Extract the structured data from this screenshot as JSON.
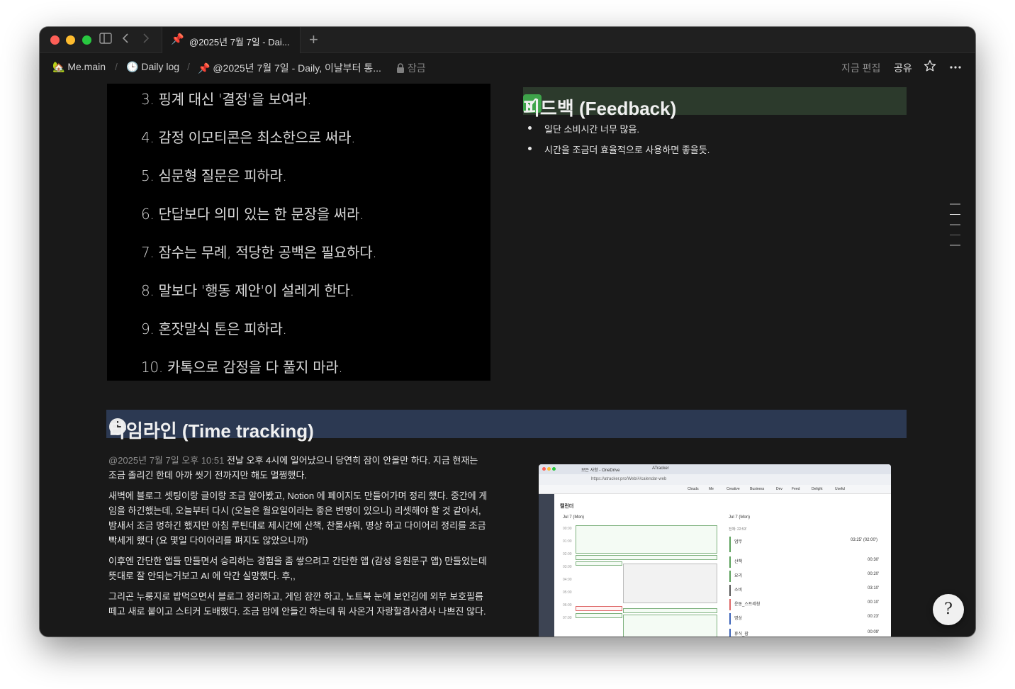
{
  "window": {
    "tab_title": "@2025년 7월 7일 - Dai...",
    "new_tab_symbol": "+"
  },
  "breadcrumb": {
    "items": [
      {
        "icon": "house-plant-emoji",
        "label": "Me.main"
      },
      {
        "icon": "clock-emoji",
        "label": "Daily log"
      },
      {
        "icon": "pushpin-emoji",
        "label": "@2025년 7월 7일 - Daily, 이날부터 통..."
      }
    ],
    "lock_label": "잠금"
  },
  "topbar": {
    "edit_label": "지금 편집",
    "share_label": "공유"
  },
  "rules_image": {
    "lines": [
      "3. 핑계 대신 '결정'을 보여라.",
      "4. 감정 이모티콘은 최소한으로 써라.",
      "5. 심문형 질문은 피하라.",
      "6. 단답보다 의미 있는 한 문장을 써라.",
      "7. 잠수는 무례, 적당한 공백은 필요하다.",
      "8. 말보다 '행동 제안'이 설레게 한다.",
      "9. 혼잣말식 톤은 피하라.",
      "10. 카톡으로 감정을 다 풀지 마라."
    ]
  },
  "feedback": {
    "heading": "피드백 (Feedback)",
    "heading_color": "#2c3a2c",
    "items": [
      "일단 소비시간 너무 많음.",
      "시간을 조금더 효율적으로 사용하면 좋을듯."
    ]
  },
  "timeline": {
    "heading": "타임라인 (Time tracking)",
    "heading_color": "#2c3952",
    "mention": "@2025년 7월 7일 오후 10:51",
    "p1_rest": " 전날 오후 4시에 일어났으니 당연히 잠이 안올만 하다. 지금 현재는 조금 졸리긴 한데 아까 씻기 전까지만 해도 멀쩡했다.",
    "p2": "새벽에 블로그 셋팅이랑 글이랑 조금 알아봤고, Notion 에 페이지도 만들어가며 정리 했다. 중간에 게임을 하긴했는데, 오늘부터 다시 (오늘은 월요일이라는 좋은 변명이 있으니) 리셋해야 할 것 같아서, 밤새서 조금 멍하긴 했지만 아침 루틴대로 제시간에 산책, 찬물샤워, 명상 하고 다이어리 정리를 조금 빡세게 했다 (요 몇일 다이어리를 펴지도 않았으니까)",
    "p3": "이후엔 간단한 앱들 만들면서 승리하는 경험을 좀 쌓으려고 간단한 앱 (감성 응원문구 앱) 만들었는데 뜻대로 잘 안되는거보고 AI 에 약간 실망했다. 후,,",
    "p4": "그리곤 누룽지로 밥먹으면서 블로그 정리하고, 게임 잠깐 하고, 노트북 눈에 보인김에 외부 보호필름 떼고 새로 붙이고 스티커 도배했다. 조금 맘에 안들긴 하는데 뭐 사온거 자랑할겸사겸사 나쁘진 않다."
  },
  "embedded_screenshot": {
    "tab1": "모든 사항 - OneDrive",
    "tab2": "ATracker",
    "url": "https://atracker.pro/Web/#/calendar-web",
    "bookmarks": [
      "Clouds",
      "Me",
      "Creative",
      "Business",
      "Dev",
      "Feed",
      "Delight",
      "Useful"
    ],
    "calendar_title": "캘린더",
    "date_left": "Jul 7 (Mon)",
    "date_right": "Jul 7 (Mon)",
    "total": "전체: 22:53'",
    "entries": [
      {
        "name": "업무",
        "time": "03:25' (02:00')"
      },
      {
        "name": "산책",
        "time": "00:30'"
      },
      {
        "name": "요리",
        "time": "00:20'"
      },
      {
        "name": "소비",
        "time": "03:10'"
      },
      {
        "name": "운동_스트레칭",
        "time": "00:10'"
      },
      {
        "name": "명상",
        "time": "00:23'"
      },
      {
        "name": "휴식_잠",
        "time": "00:09'"
      }
    ],
    "hours": [
      "00:00",
      "01:00",
      "02:00",
      "03:00",
      "04:00",
      "05:00",
      "06:00",
      "07:00"
    ]
  },
  "help_button": {
    "label": "?"
  }
}
